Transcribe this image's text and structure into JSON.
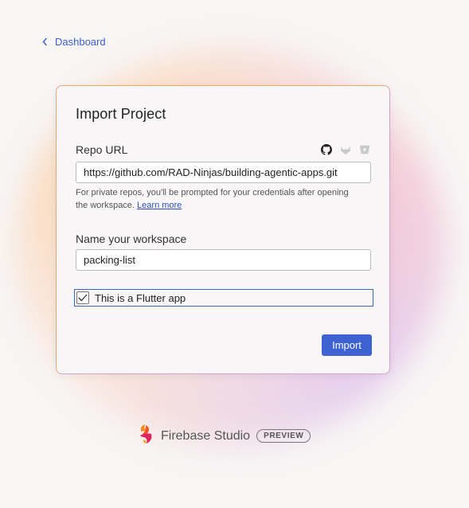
{
  "nav": {
    "back_label": "Dashboard"
  },
  "dialog": {
    "title": "Import Project",
    "repo_url_label": "Repo URL",
    "repo_url_value": "https://github.com/RAD-Ninjas/building-agentic-apps.git",
    "provider_icons": [
      "github-icon",
      "gitlab-icon",
      "bitbucket-icon"
    ],
    "helper_text": "For private repos, you'll be prompted for your credentials after opening the workspace.",
    "learn_more_label": "Learn more",
    "workspace_label": "Name your workspace",
    "workspace_value": "packing-list",
    "flutter_checkbox_label": "This is a Flutter app",
    "flutter_checked": true,
    "import_button_label": "Import"
  },
  "footer": {
    "brand_name": "Firebase Studio",
    "badge": "PREVIEW"
  },
  "colors": {
    "accent": "#3e63d0",
    "link": "#3a5fcd",
    "card_border": "#e9a774"
  }
}
